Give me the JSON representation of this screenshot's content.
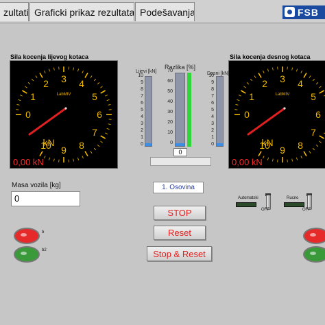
{
  "tabs": [
    {
      "label": "zultati",
      "active": false
    },
    {
      "label": "Graficki prikaz rezultata",
      "active": false
    },
    {
      "label": "Podešavanja",
      "active": false
    }
  ],
  "logo": {
    "text": "FSB"
  },
  "left_gauge": {
    "title": "Sila kocenja lijevog kotaca",
    "brand": "LabMIV",
    "unit": "kN",
    "readout": "0,00 kN",
    "scale": [
      "0",
      "1",
      "2",
      "3",
      "4",
      "5",
      "6",
      "7",
      "8",
      "9",
      "10"
    ],
    "value": 0.0
  },
  "right_gauge": {
    "title": "Sila kocenja desnog kotaca",
    "brand": "LabMIV",
    "unit": "kN",
    "readout": "0,00 kN",
    "scale": [
      "0",
      "1",
      "2",
      "3",
      "4",
      "5",
      "6",
      "7",
      "8",
      "9",
      "10"
    ],
    "value": 0.0
  },
  "bars": {
    "left": {
      "label": "Lijevi [kN]",
      "ticks": [
        "10",
        "9",
        "8",
        "7",
        "6",
        "5",
        "4",
        "3",
        "2",
        "1",
        "0"
      ],
      "value": 0.0
    },
    "diff": {
      "label": "Razlika [%]",
      "ticks": [
        "70",
        "60",
        "50",
        "40",
        "30",
        "20",
        "10",
        "0"
      ],
      "value": 0.0,
      "readout": "0"
    },
    "right": {
      "label": "Desni [kN]",
      "ticks": [
        "10",
        "9",
        "8",
        "7",
        "6",
        "5",
        "4",
        "3",
        "2",
        "1",
        "0"
      ],
      "value": 0.0
    }
  },
  "mass": {
    "label": "Masa vozila [kg]",
    "value": "0"
  },
  "axle": {
    "label": "1. Osovina"
  },
  "buttons": {
    "stop": "STOP",
    "reset": "Reset",
    "stop_reset": "Stop & Reset"
  },
  "leds_left": {
    "b": "b",
    "b2": "b2"
  },
  "switches": {
    "auto_label": "Automatski",
    "manual_label": "Rucno",
    "off": "OFF"
  },
  "colors": {
    "led_red": "#e62a2a",
    "led_green": "#3a9a3a",
    "needle": "#e02020",
    "gauge_text": "#f0b800",
    "bar_blue": "#3a8ee6",
    "green_bar": "#2fd63a",
    "button_text": "#e32020"
  }
}
